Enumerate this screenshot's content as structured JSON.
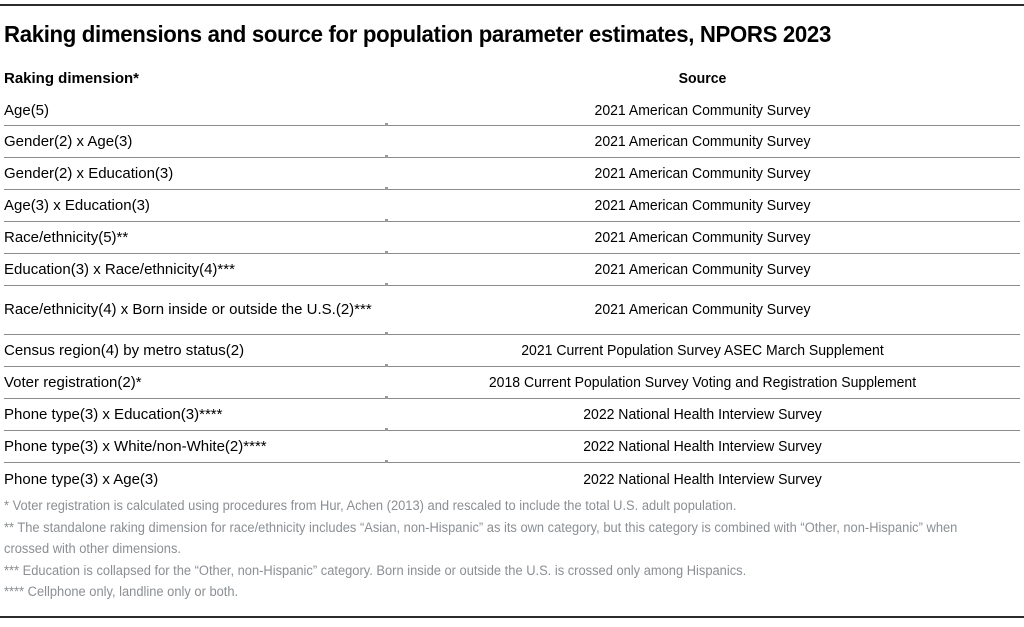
{
  "title": "Raking dimensions and source for population parameter estimates, NPORS 2023",
  "table": {
    "columns": {
      "dimension": "Raking dimension*",
      "source": "Source"
    },
    "rows": [
      {
        "dimension": "Age(5)",
        "source": "2021 American Community Survey"
      },
      {
        "dimension": "Gender(2) x Age(3)",
        "source": "2021 American Community Survey"
      },
      {
        "dimension": "Gender(2) x Education(3)",
        "source": "2021 American Community Survey"
      },
      {
        "dimension": "Age(3) x Education(3)",
        "source": "2021 American Community Survey"
      },
      {
        "dimension": "Race/ethnicity(5)**",
        "source": "2021 American Community Survey"
      },
      {
        "dimension": "Education(3) x Race/ethnicity(4)***",
        "source": "2021 American Community Survey"
      },
      {
        "dimension": "Race/ethnicity(4) x Born inside or outside the U.S.(2)***",
        "source": "2021 American Community Survey"
      },
      {
        "dimension": "Census region(4) by metro status(2)",
        "source": "2021 Current Population Survey ASEC March Supplement"
      },
      {
        "dimension": "Voter registration(2)*",
        "source": "2018 Current Population Survey Voting and Registration Supplement"
      },
      {
        "dimension": "Phone type(3) x Education(3)****",
        "source": "2022 National Health Interview Survey"
      },
      {
        "dimension": "Phone type(3) x White/non-White(2)****",
        "source": "2022 National Health Interview Survey"
      },
      {
        "dimension": "Phone type(3) x Age(3)",
        "source": "2022 National Health Interview Survey"
      }
    ]
  },
  "footnotes": [
    "* Voter registration is calculated using procedures from Hur, Achen (2013) and rescaled to include the total U.S. adult population.",
    "** The standalone raking dimension for race/ethnicity includes “Asian, non-Hispanic” as its own category, but this category is combined with “Other, non-Hispanic” when crossed with other dimensions.",
    "*** Education is collapsed for the “Other, non-Hispanic” category. Born inside or outside the U.S. is crossed only among Hispanics.",
    "**** Cellphone only, landline only or both."
  ],
  "colors": {
    "rule": "#2b2b2b",
    "row_separator": "#8c8c8c",
    "footnote_text": "#8b8f93",
    "body_text": "#000000"
  }
}
